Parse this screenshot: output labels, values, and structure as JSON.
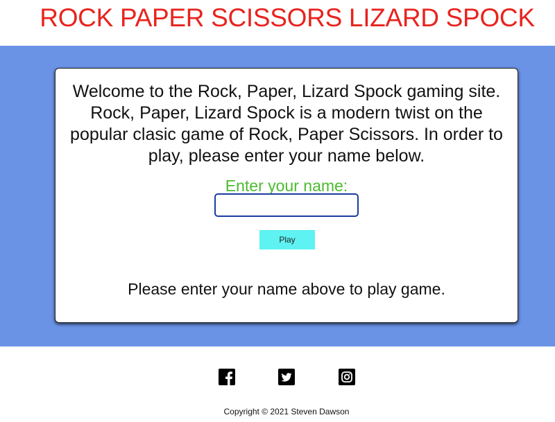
{
  "header": {
    "title": "ROCK PAPER SCISSORS LIZARD SPOCK"
  },
  "card": {
    "intro": "Welcome to the Rock, Paper, Lizard Spock gaming site. Rock, Paper, Lizard Spock is a modern twist on the popular clasic game of Rock, Paper Scissors. In order to play, please enter your name below.",
    "name_label": "Enter your name:",
    "name_value": "",
    "play_label": "Play",
    "status": "Please enter your name above to play game."
  },
  "footer": {
    "social": [
      {
        "icon": "facebook-icon"
      },
      {
        "icon": "twitter-icon"
      },
      {
        "icon": "instagram-icon"
      }
    ],
    "copyright": "Copyright © 2021 Steven Dawson"
  },
  "colors": {
    "title": "#e8231e",
    "band": "#6a93e6",
    "label": "#4cbb2f",
    "button": "#5ef2f2"
  }
}
